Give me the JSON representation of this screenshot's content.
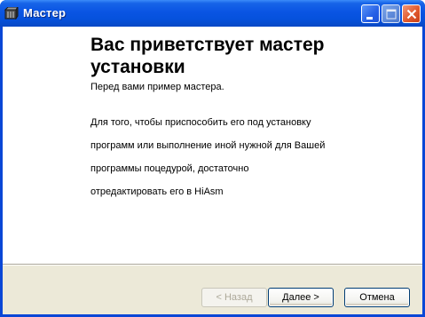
{
  "window": {
    "title": "Мастер",
    "icon": "app-icon",
    "controls": {
      "minimize": "minimize-icon",
      "maximize": "maximize-icon",
      "close": "close-icon"
    }
  },
  "content": {
    "heading_line1": "Вас приветствует мастер",
    "heading_line2": "установки",
    "intro": "Перед вами пример мастера.",
    "description_lines": [
      "Для того, чтобы приспособить его под установку",
      "программ или выполнение иной нужной для Вашей",
      "программы поцедурой, достаточно",
      "отредактировать его в HiAsm"
    ]
  },
  "buttons": {
    "back": "< Назад",
    "next": "Далее >",
    "cancel": "Отмена"
  },
  "colors": {
    "titlebar": "#0a54e3",
    "footer": "#ece9d8",
    "client": "#ffffff"
  }
}
